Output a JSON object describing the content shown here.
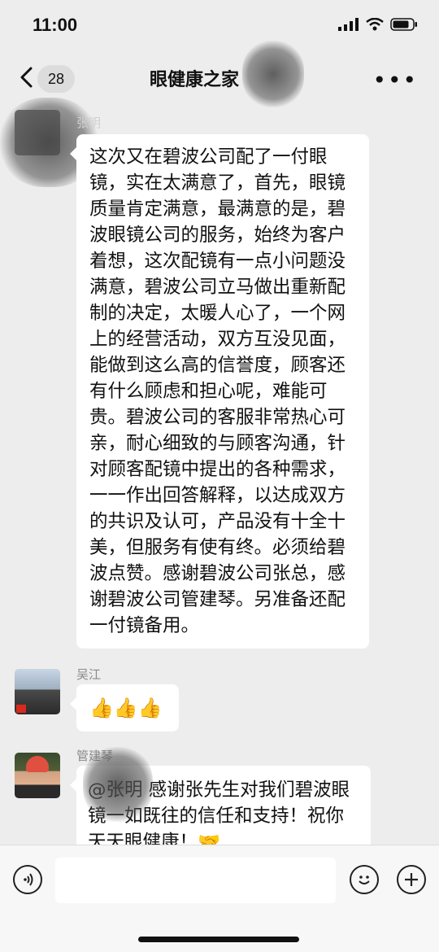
{
  "status": {
    "time": "11:00"
  },
  "header": {
    "back_label": "<",
    "unread_count": "28",
    "title": "眼健康之家",
    "more_label": "•••"
  },
  "messages": [
    {
      "sender": "张明",
      "text": "这次又在碧波公司配了一付眼镜，实在太满意了，首先，眼镜质量肯定满意，最满意的是，碧波眼镜公司的服务，始终为客户着想，这次配镜有一点小问题没满意，碧波公司立马做出重新配制的决定，太暖人心了，一个网上的经营活动，双方互没见面，能做到这么高的信誉度，顾客还有什么顾虑和担心呢，难能可贵。碧波公司的客服非常热心可亲，耐心细致的与顾客沟通，针对顾客配镜中提出的各种需求，一一作出回答解释，以达成双方的共识及认可，产品没有十全十美，但服务有使有终。必须给碧波点赞。感谢碧波公司张总，感谢碧波公司管建琴。另准备还配一付镜备用。"
    },
    {
      "sender": "吴江",
      "text": "👍👍👍"
    },
    {
      "sender": "管建琴",
      "text": "@张明 感谢张先生对我们碧波眼镜一如既往的信任和支持！祝你天天眼健康！🤝"
    }
  ],
  "colors": {
    "background": "#ededed",
    "bubble": "#ffffff",
    "sender_name": "#8a8a8a"
  }
}
